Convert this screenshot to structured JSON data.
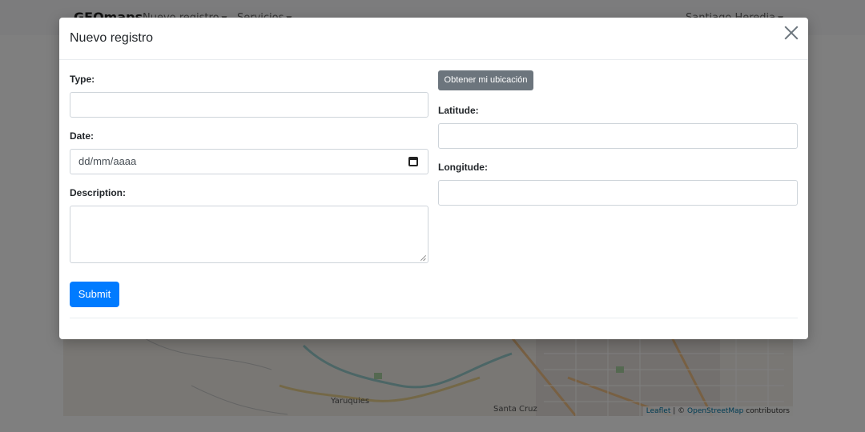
{
  "navbar": {
    "brand": "GEOmaps",
    "items": [
      {
        "label": "Nuevo registro"
      },
      {
        "label": "Servicios"
      }
    ],
    "user": "Santiago Heredia"
  },
  "map": {
    "places": [
      "Yaruquies",
      "Santa Cruz"
    ],
    "attribution": {
      "leaflet": "Leaflet",
      "sep": " | © ",
      "osm": "OpenStreetMap",
      "tail": " contributors"
    }
  },
  "modal": {
    "title": "Nuevo registro",
    "form": {
      "type": {
        "label": "Type:",
        "value": ""
      },
      "date": {
        "label": "Date:",
        "placeholder": "dd/mm/aaaa"
      },
      "description": {
        "label": "Description:",
        "value": ""
      },
      "location_button": "Obtener mi ubicación",
      "latitude": {
        "label": "Latitude:",
        "value": ""
      },
      "longitude": {
        "label": "Longitude:",
        "value": ""
      },
      "submit": "Submit"
    }
  },
  "colors": {
    "primary": "#007bff",
    "secondary": "#6c757d",
    "backdrop": "rgba(0,0,0,0.5)"
  },
  "icons": [
    "close-icon",
    "calendar-icon",
    "caret-down-icon",
    "resize-grip-icon"
  ]
}
